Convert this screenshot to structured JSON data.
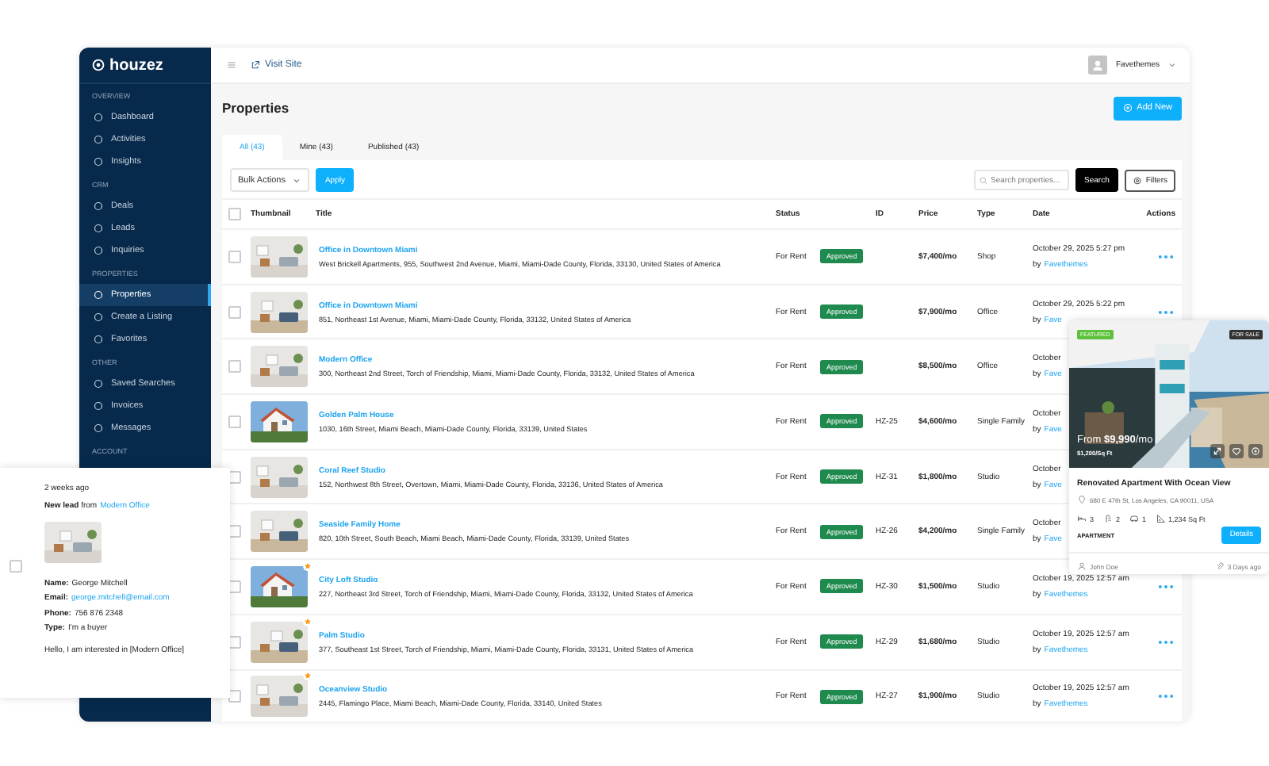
{
  "sidebar": {
    "logo": "houzez",
    "sections": [
      {
        "heading": "OVERVIEW",
        "items": [
          {
            "label": "Dashboard",
            "selected": false
          },
          {
            "label": "Activities",
            "selected": false
          },
          {
            "label": "Insights",
            "selected": false
          }
        ]
      },
      {
        "heading": "CRM",
        "items": [
          {
            "label": "Deals",
            "selected": false
          },
          {
            "label": "Leads",
            "selected": false
          },
          {
            "label": "Inquiries",
            "selected": false
          }
        ]
      },
      {
        "heading": "PROPERTIES",
        "items": [
          {
            "label": "Properties",
            "selected": true
          },
          {
            "label": "Create a Listing",
            "selected": false
          },
          {
            "label": "Favorites",
            "selected": false
          }
        ]
      },
      {
        "heading": "OTHER",
        "items": [
          {
            "label": "Saved Searches",
            "selected": false
          },
          {
            "label": "Invoices",
            "selected": false
          },
          {
            "label": "Messages",
            "selected": false
          }
        ]
      },
      {
        "heading": "ACCOUNT"
      }
    ]
  },
  "topbar": {
    "link": "Visit Site",
    "user": "Favethemes"
  },
  "page": {
    "title": "Properties",
    "add_button": "Add New"
  },
  "tabs": [
    {
      "label": "All (43)",
      "selected": true
    },
    {
      "label": "Mine (43)",
      "selected": false
    },
    {
      "label": "Published (43)",
      "selected": false
    }
  ],
  "toolbar": {
    "bulk_actions": "Bulk Actions",
    "apply": "Apply",
    "search_placeholder": "Search properties...",
    "search_button": "Search",
    "filters": "Filters"
  },
  "table": {
    "all_checked": false,
    "columns": [
      "Thumbnail",
      "Title",
      "Status",
      "ID",
      "Price",
      "Type",
      "Date",
      "Actions"
    ],
    "rows": [
      {
        "title": "Office in Downtown Miami",
        "address": "West Brickell Apartments, 955, Southwest 2nd Avenue, Miami, Miami-Dade County, Florida, 33130, United States of America",
        "offer": "For Rent",
        "status": "Approved",
        "price": "$7,400/mo",
        "type": "Shop",
        "date": "October 29, 2025 5:27 pm",
        "by": "by",
        "author": "Favethemes",
        "checked": false,
        "featured": false,
        "menu": true
      },
      {
        "title": "Office in Downtown Miami",
        "address": "851, Northeast 1st Avenue, Miami, Miami-Dade County, Florida, 33132, United States of America",
        "offer": "For Rent",
        "status": "Approved",
        "price": "$7,900/mo",
        "type": "Office",
        "date": "October 29, 2025 5:22 pm",
        "by": "by",
        "author": "Fave",
        "checked": false,
        "featured": false,
        "menu": true
      },
      {
        "title": "Modern Office",
        "address": "300, Northeast 2nd Street, Torch of Friendship, Miami, Miami-Dade County, Florida, 33132, United States of America",
        "offer": "For Rent",
        "status": "Approved",
        "price": "$8,500/mo",
        "type": "Office",
        "date": "October",
        "by": "by",
        "author": "Fave",
        "checked": false,
        "featured": false,
        "menu": false
      },
      {
        "title": "Golden Palm House",
        "address": "1030, 16th Street, Miami Beach, Miami-Dade County, Florida, 33139, United States",
        "offer": "For Rent",
        "status": "Approved",
        "id": "HZ-25",
        "price": "$4,600/mo",
        "type": "Single Family",
        "date": "October",
        "by": "by",
        "author": "Fave",
        "checked": false,
        "featured": false,
        "menu": false
      },
      {
        "title": "Coral Reef Studio",
        "address": "152, Northwest 8th Street, Overtown, Miami, Miami-Dade County, Florida, 33136, United States of America",
        "offer": "For Rent",
        "status": "Approved",
        "id": "HZ-31",
        "price": "$1,800/mo",
        "type": "Studio",
        "date": "October",
        "by": "by",
        "author": "Fave",
        "checked": false,
        "featured": false,
        "menu": false
      },
      {
        "title": "Seaside Family Home",
        "address": "820, 10th Street, South Beach, Miami Beach, Miami-Dade County, Florida, 33139, United States",
        "offer": "For Rent",
        "status": "Approved",
        "id": "HZ-26",
        "price": "$4,200/mo",
        "type": "Single Family",
        "date": "October",
        "by": "by",
        "author": "Fave",
        "checked": false,
        "featured": false,
        "menu": false
      },
      {
        "title": "City Loft Studio",
        "address": "227, Northeast 3rd Street, Torch of Friendship, Miami, Miami-Dade County, Florida, 33132, United States of America",
        "offer": "For Rent",
        "status": "Approved",
        "id": "HZ-30",
        "price": "$1,500/mo",
        "type": "Studio",
        "date": "October 19, 2025 12:57 am",
        "by": "by",
        "author": "Favethemes",
        "checked": false,
        "featured": true,
        "menu": true
      },
      {
        "title": "Palm Studio",
        "address": "377, Southeast 1st Street, Torch of Friendship, Miami, Miami-Dade County, Florida, 33131, United States of America",
        "offer": "For Rent",
        "status": "Approved",
        "id": "HZ-29",
        "price": "$1,680/mo",
        "type": "Studio",
        "date": "October 19, 2025 12:57 am",
        "by": "by",
        "author": "Favethemes",
        "checked": false,
        "featured": true,
        "menu": true
      },
      {
        "title": "Oceanview Studio",
        "address": "2445, Flamingo Place, Miami Beach, Miami-Dade County, Florida, 33140, United States",
        "offer": "For Rent",
        "status": "Approved",
        "id": "HZ-27",
        "price": "$1,900/mo",
        "type": "Studio",
        "date": "October 19, 2025 12:57 am",
        "by": "by",
        "author": "Favethemes",
        "checked": false,
        "featured": true,
        "menu": true
      }
    ]
  },
  "lead_popup": {
    "time": "2 weeks ago",
    "headline": "**New lead** from",
    "property": "Modern Office",
    "fields": [
      {
        "label": "Name:",
        "value": "George Mitchell",
        "kind": "text"
      },
      {
        "label": "Email:",
        "value": "george.mitchell@email.com",
        "kind": "link"
      },
      {
        "label": "Phone:",
        "value": "756 876 2348",
        "kind": "text"
      },
      {
        "label": "Type:",
        "value": "I'm a buyer",
        "kind": "text"
      }
    ],
    "message": "Hello, I am interested in [Modern Office]",
    "checked": false
  },
  "listing_card": {
    "badge": "FEATURED",
    "label": "FOR SALE",
    "price": "From **$9,990**/mo",
    "price_per_area": "$1,200/Sq Ft",
    "title": "Renovated Apartment With Ocean View",
    "address": "680 E 47th St, Los Angeles, CA 90011, USA",
    "features": [
      {
        "kind": "bed",
        "value": "3"
      },
      {
        "kind": "bath",
        "value": "2"
      },
      {
        "kind": "garage",
        "value": "1"
      },
      {
        "kind": "area",
        "value": "1,234 Sq Ft"
      }
    ],
    "type": "APARTMENT",
    "button": "Details",
    "agent": "John Doe",
    "posted": "3 Days ago"
  }
}
